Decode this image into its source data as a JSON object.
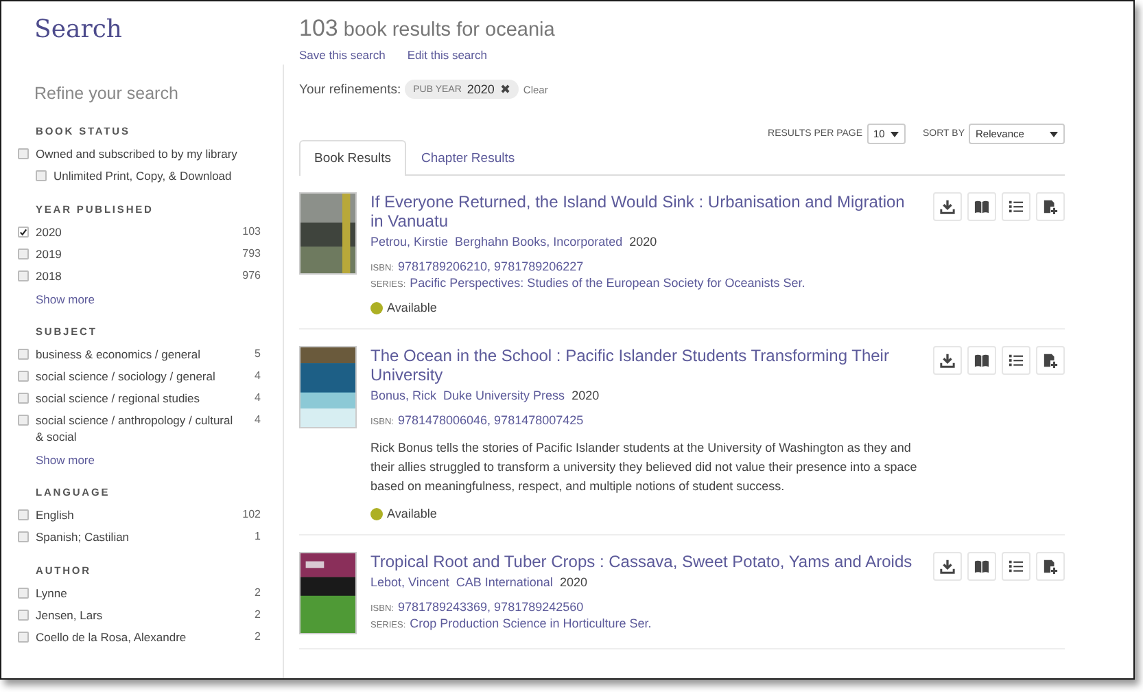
{
  "sidebar": {
    "title": "Search",
    "subtitle": "Refine your search",
    "facets": [
      {
        "heading": "BOOK STATUS",
        "options": [
          {
            "label": "Owned and subscribed to by my library",
            "checked": false,
            "children": [
              {
                "label": "Unlimited Print, Copy, & Download",
                "checked": false
              }
            ]
          }
        ]
      },
      {
        "heading": "YEAR PUBLISHED",
        "options": [
          {
            "label": "2020",
            "count": "103",
            "checked": true
          },
          {
            "label": "2019",
            "count": "793",
            "checked": false
          },
          {
            "label": "2018",
            "count": "976",
            "checked": false
          }
        ],
        "more": "Show more"
      },
      {
        "heading": "SUBJECT",
        "options": [
          {
            "label": "business & economics / general",
            "count": "5",
            "checked": false
          },
          {
            "label": "social science / sociology / general",
            "count": "4",
            "checked": false
          },
          {
            "label": "social science / regional studies",
            "count": "4",
            "checked": false
          },
          {
            "label": "social science / anthropology / cultural & social",
            "count": "4",
            "checked": false
          }
        ],
        "more": "Show more"
      },
      {
        "heading": "LANGUAGE",
        "options": [
          {
            "label": "English",
            "count": "102",
            "checked": false
          },
          {
            "label": "Spanish; Castilian",
            "count": "1",
            "checked": false
          }
        ]
      },
      {
        "heading": "AUTHOR",
        "options": [
          {
            "label": "Lynne",
            "count": "2",
            "checked": false
          },
          {
            "label": "Jensen, Lars",
            "count": "2",
            "checked": false
          },
          {
            "label": "Coello de la Rosa, Alexandre",
            "count": "2",
            "checked": false
          }
        ]
      }
    ]
  },
  "results": {
    "count": "103",
    "heading": "book results for oceania",
    "links": [
      "Save this search",
      "Edit this search"
    ],
    "refinements": {
      "label": "Your refinements:",
      "chips": [
        {
          "field": "PUB YEAR",
          "value": "2020",
          "remove": "✖"
        }
      ],
      "clear": "Clear"
    },
    "per_page": {
      "label": "RESULTS PER PAGE",
      "value": "10"
    },
    "sort": {
      "label": "SORT BY",
      "value": "Relevance"
    },
    "tabs": [
      {
        "label": "Book Results",
        "selected": true
      },
      {
        "label": "Chapter Results",
        "selected": false
      }
    ],
    "books": [
      {
        "title": "If Everyone Returned, the Island Would Sink : Urbanisation and Migration in Vanuatu",
        "author": "Petrou, Kirstie",
        "publisher": "Berghahn Books, Incorporated",
        "year": "2020",
        "isbn_label": "ISBN:",
        "isbn": "9781789206210, 9781789206227",
        "series_label": "SERIES:",
        "series": "Pacific Perspectives: Studies of the European Society for Oceanists Ser.",
        "status": "Available"
      },
      {
        "title": "The Ocean in the School : Pacific Islander Students Transforming Their University",
        "author": "Bonus, Rick",
        "publisher": "Duke University Press",
        "year": "2020",
        "isbn_label": "ISBN:",
        "isbn": "9781478006046, 9781478007425",
        "description": "Rick Bonus tells the stories of Pacific Islander students at the University of Washington as they and their allies struggled to transform a university they believed did not value their presence into a space based on meaningfulness, respect, and multiple notions of student success.",
        "status": "Available"
      },
      {
        "title": "Tropical Root and Tuber Crops : Cassava, Sweet Potato, Yams and Aroids",
        "author": "Lebot, Vincent",
        "publisher": "CAB International",
        "year": "2020",
        "isbn_label": "ISBN:",
        "isbn": "9781789243369, 9781789242560",
        "series_label": "SERIES:",
        "series": "Crop Production Science in Horticulture Ser."
      }
    ]
  }
}
